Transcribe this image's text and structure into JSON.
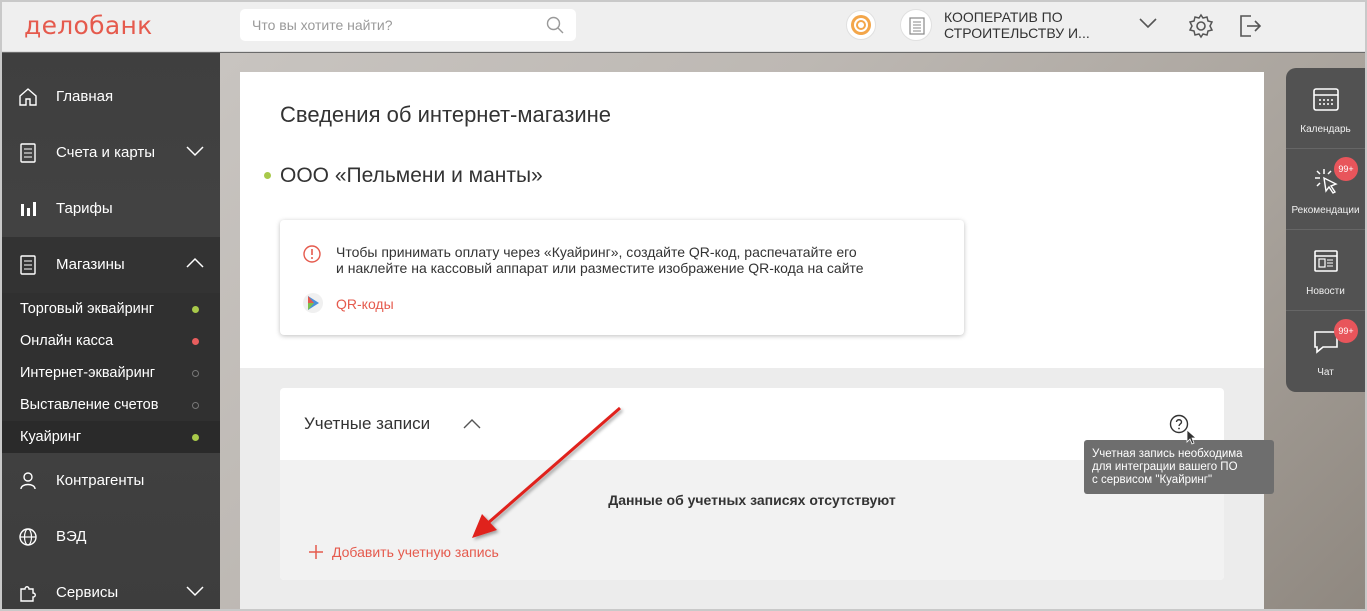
{
  "header": {
    "logo": "делобанк",
    "search_placeholder": "Что вы хотите найти?",
    "org_name_line1": "КООПЕРАТИВ ПО",
    "org_name_line2": "СТРОИТЕЛЬСТВУ И..."
  },
  "sidebar": {
    "items": [
      {
        "label": "Главная",
        "icon": "home-icon"
      },
      {
        "label": "Счета и карты",
        "icon": "document-icon"
      },
      {
        "label": "Тарифы",
        "icon": "bar-chart-icon"
      },
      {
        "label": "Магазины",
        "icon": "document-icon"
      },
      {
        "label": "Контрагенты",
        "icon": "person-icon"
      },
      {
        "label": "ВЭД",
        "icon": "globe-icon"
      },
      {
        "label": "Сервисы",
        "icon": "puzzle-icon"
      }
    ],
    "sub_items": [
      {
        "label": "Торговый эквайринг",
        "status": "green"
      },
      {
        "label": "Онлайн касса",
        "status": "red"
      },
      {
        "label": "Интернет-эквайринг",
        "status": "empty"
      },
      {
        "label": "Выставление счетов",
        "status": "empty"
      },
      {
        "label": "Куайринг",
        "status": "green",
        "active": true
      }
    ]
  },
  "main": {
    "page_title": "Сведения об интернет-магазине",
    "shop_name": "ООО «Пельмени и манты»",
    "info_line1": "Чтобы принимать оплату через «Куайринг», создайте QR-код, распечатайте его",
    "info_line2": "и наклейте на кассовый аппарат или разместите изображение QR-кода на сайте",
    "qr_link": "QR-коды",
    "accounts_title": "Учетные записи",
    "empty_text": "Данные об учетных записях отсутствуют",
    "add_account": "Добавить учетную запись",
    "tooltip_line1": "Учетная запись необходима",
    "tooltip_line2": "для интеграции вашего ПО",
    "tooltip_line3": "с сервисом \"Куайринг\""
  },
  "rail": {
    "items": [
      {
        "label": "Календарь",
        "icon": "calendar-icon"
      },
      {
        "label": "Рекомендации",
        "icon": "click-icon",
        "badge": "99+"
      },
      {
        "label": "Новости",
        "icon": "news-icon"
      },
      {
        "label": "Чат",
        "icon": "chat-icon",
        "badge": "99+"
      }
    ]
  },
  "colors": {
    "accent": "#e55a4d",
    "status_green": "#a8c94a",
    "status_red": "#e85d5d",
    "badge": "#e8555b"
  }
}
